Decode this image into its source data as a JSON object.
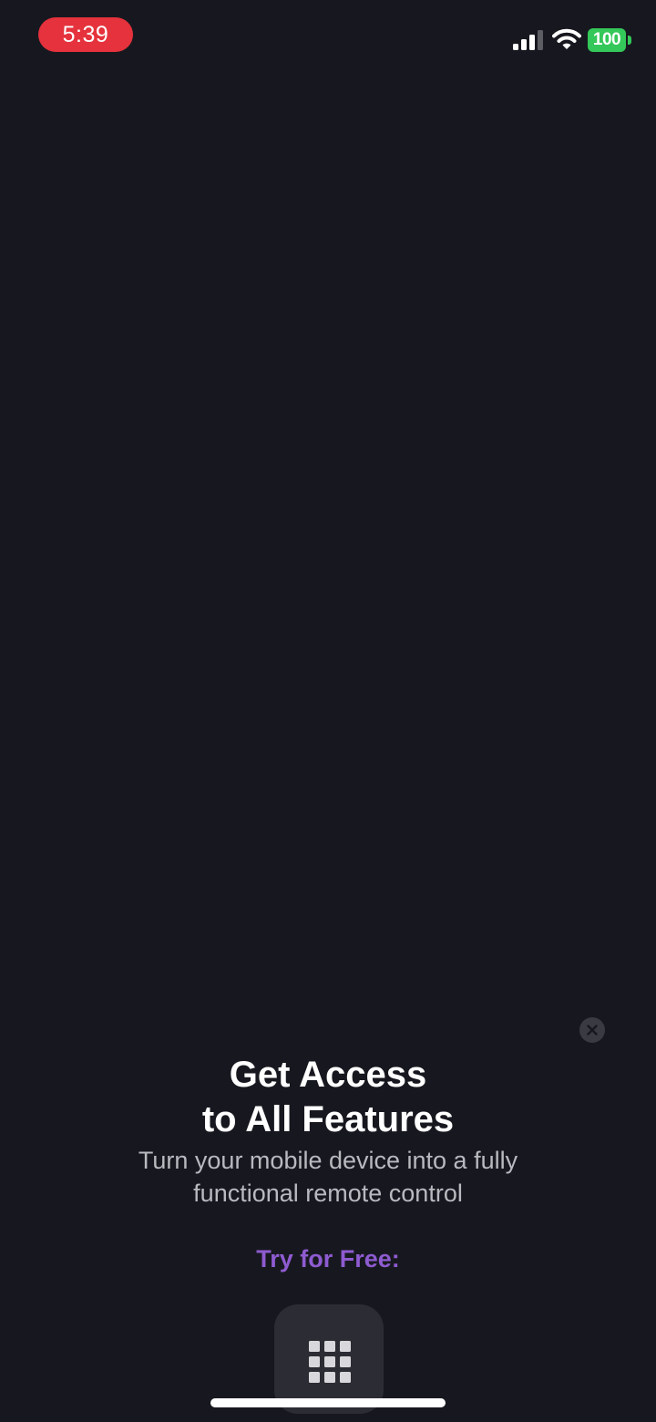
{
  "status_bar": {
    "time": "5:39",
    "battery_level": "100",
    "signal_icon": "cellular-signal-icon",
    "wifi_icon": "wifi-icon",
    "colors": {
      "time_pill": "#e5323c",
      "battery": "#34c759"
    }
  },
  "promo": {
    "title_line1": "Get Access",
    "title_line2": "to All Features",
    "subtitle_line1": "Turn your mobile device into a fully",
    "subtitle_line2": "functional remote control",
    "try_free": "Try for Free:",
    "close_icon": "close-icon",
    "feature_icon": "grid-icon",
    "colors": {
      "background": "#17181f",
      "accent": "#8e5bd0"
    }
  }
}
